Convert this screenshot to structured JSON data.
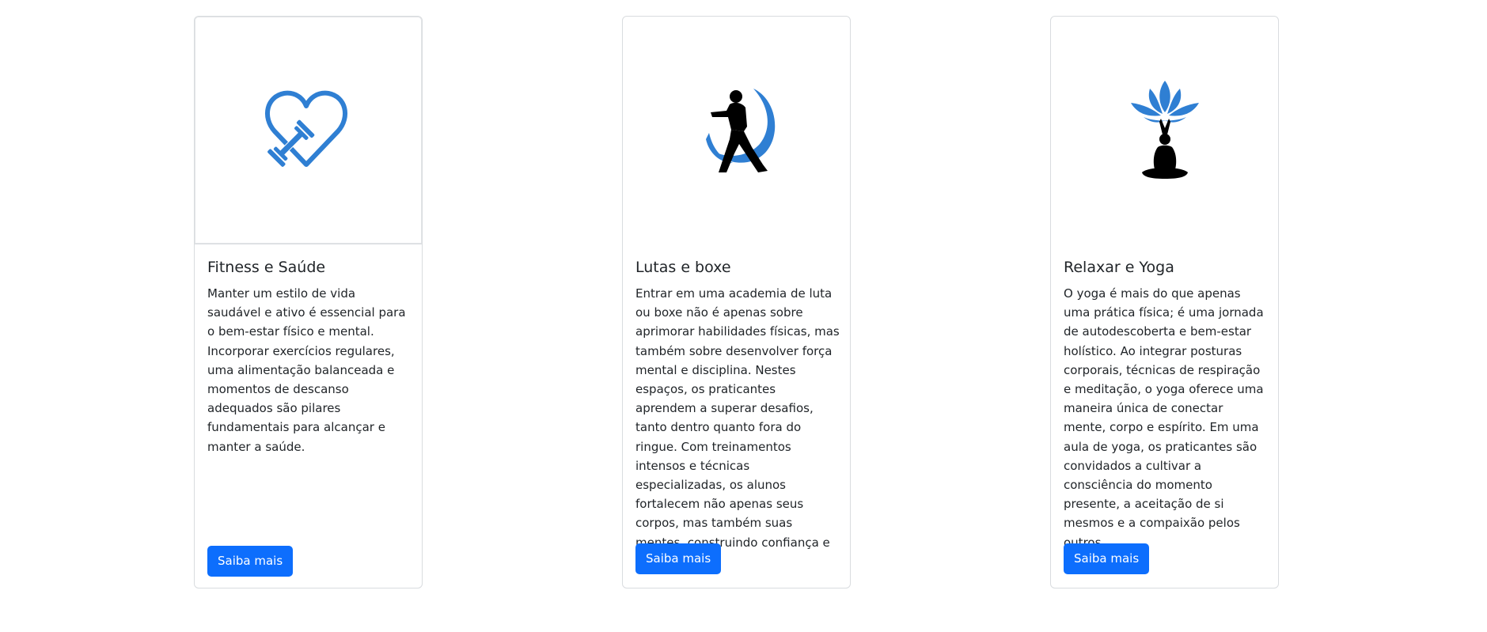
{
  "cards": [
    {
      "title": "Fitness e Saúde",
      "text": "Manter um estilo de vida saudável e ativo é essencial para o bem-estar físico e mental. Incorporar exercícios regulares, uma alimentação balanceada e momentos de descanso adequados são pilares fundamentais para alcançar e manter a saúde.",
      "button": "Saiba mais",
      "icon": "heart-dumbbell-icon"
    },
    {
      "title": "Lutas e boxe",
      "text": "Entrar em uma academia de luta ou boxe não é apenas sobre aprimorar habilidades físicas, mas também sobre desenvolver força mental e disciplina. Nestes espaços, os praticantes aprendem a superar desafios, tanto dentro quanto fora do ringue. Com treinamentos intensos e técnicas especializadas, os alunos fortalecem não apenas seus corpos, mas também suas mentes, construindo confiança e resiliência.",
      "button": "Saiba mais",
      "icon": "martial-artist-icon"
    },
    {
      "title": "Relaxar e Yoga",
      "text": "O yoga é mais do que apenas uma prática física; é uma jornada de autodescoberta e bem-estar holístico. Ao integrar posturas corporais, técnicas de respiração e meditação, o yoga oferece uma maneira única de conectar mente, corpo e espírito. Em uma aula de yoga, os praticantes são convidados a cultivar a consciência do momento presente, a aceitação de si mesmos e a compaixão pelos outros.",
      "button": "Saiba mais",
      "icon": "lotus-yoga-icon"
    }
  ],
  "colors": {
    "accent": "#0d6efd",
    "icon_blue": "#2f7fd3",
    "text": "#212529",
    "border": "#d9dcdf"
  }
}
